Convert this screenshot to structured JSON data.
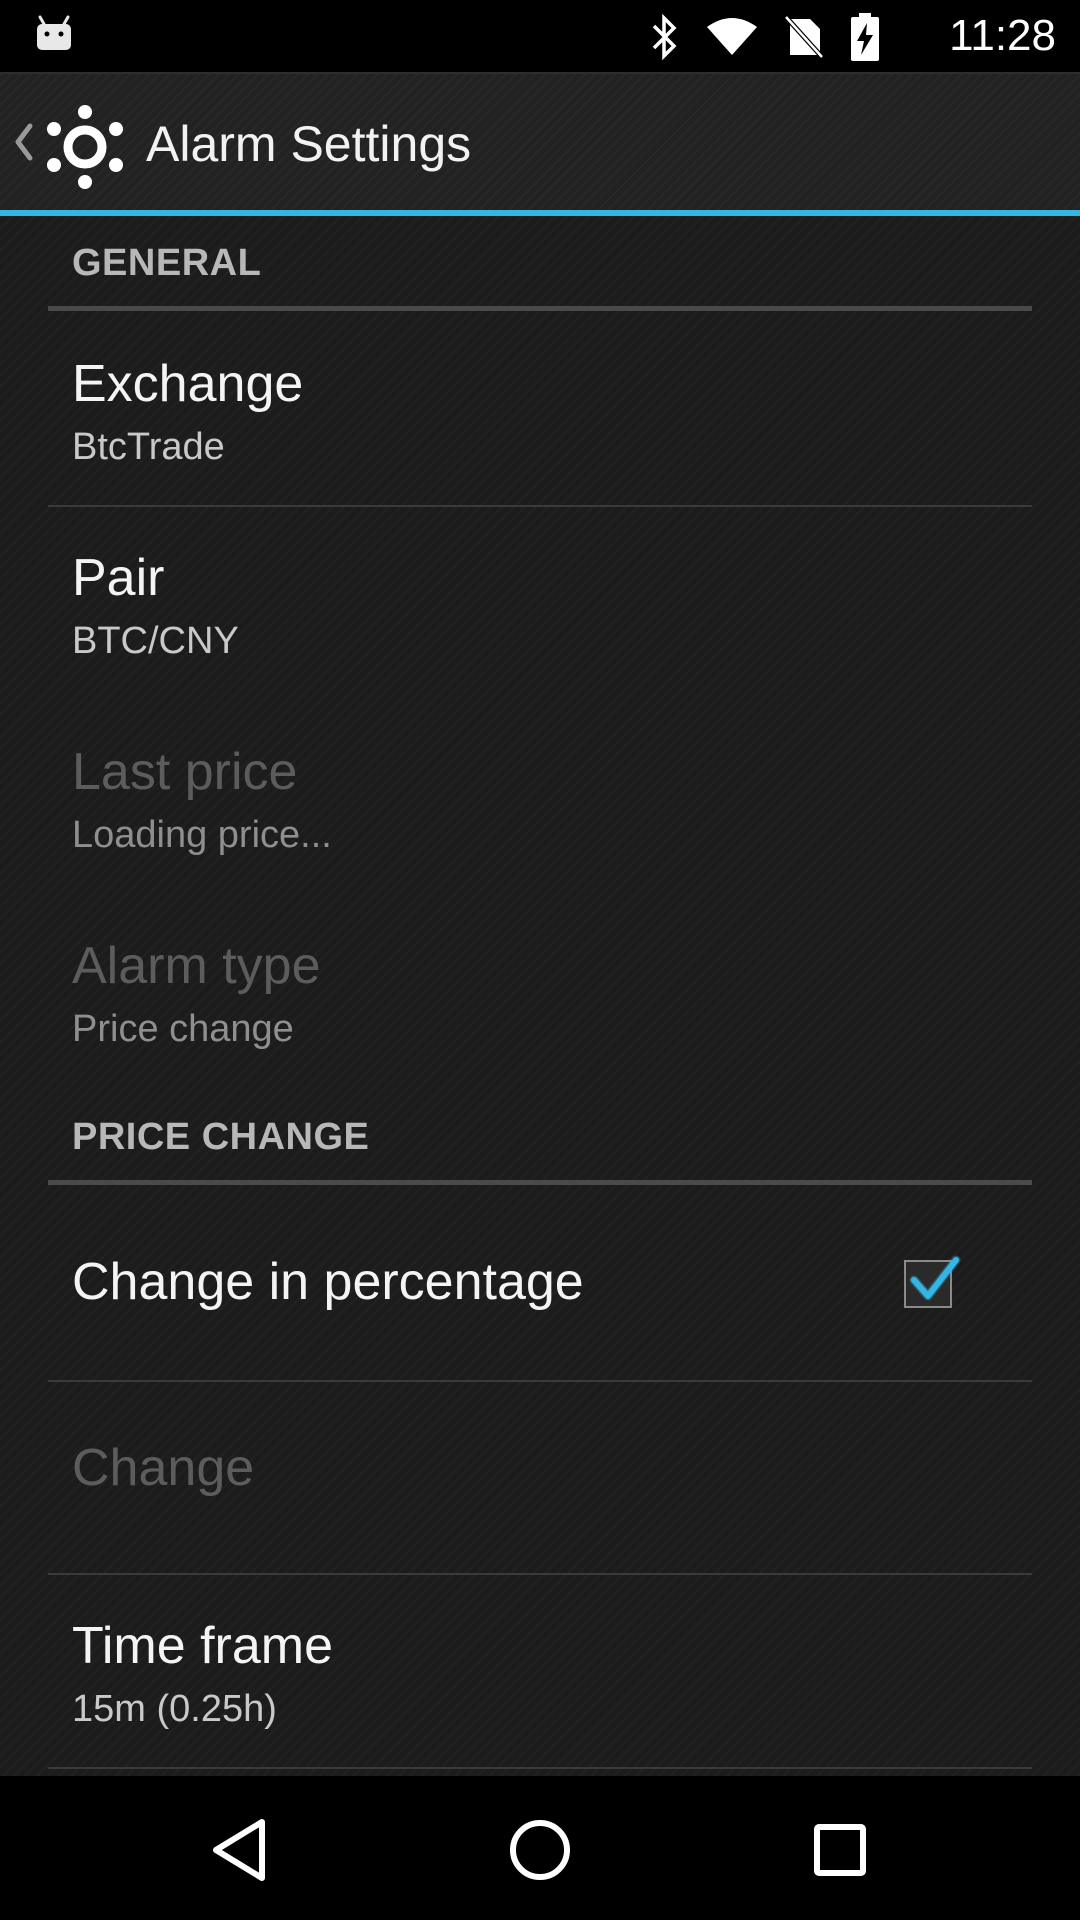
{
  "status_bar": {
    "time": "11:28",
    "icons": [
      "android-icon",
      "bluetooth-icon",
      "wifi-icon",
      "no-sim-icon",
      "battery-charging-icon"
    ]
  },
  "action_bar": {
    "title": "Alarm Settings",
    "icons": [
      "back-chevron-icon",
      "app-logo-icon"
    ]
  },
  "sections": {
    "general": {
      "header": "GENERAL",
      "exchange": {
        "title": "Exchange",
        "summary": "BtcTrade"
      },
      "pair": {
        "title": "Pair",
        "summary": "BTC/CNY"
      },
      "last_price": {
        "title": "Last price",
        "summary": "Loading price..."
      },
      "alarm_type": {
        "title": "Alarm type",
        "summary": "Price change"
      }
    },
    "price_change": {
      "header": "PRICE CHANGE",
      "change_in_percentage": {
        "title": "Change in percentage",
        "checked": true
      },
      "change": {
        "title": "Change"
      },
      "time_frame": {
        "title": "Time frame",
        "summary": "15m (0.25h)"
      }
    }
  },
  "nav_bar": {
    "icons": [
      "back-triangle-icon",
      "home-circle-icon",
      "recents-square-icon"
    ]
  },
  "colors": {
    "accent": "#33b5e5",
    "background": "#1c1c1c",
    "status_bar": "#000000",
    "nav_bar": "#000000"
  }
}
